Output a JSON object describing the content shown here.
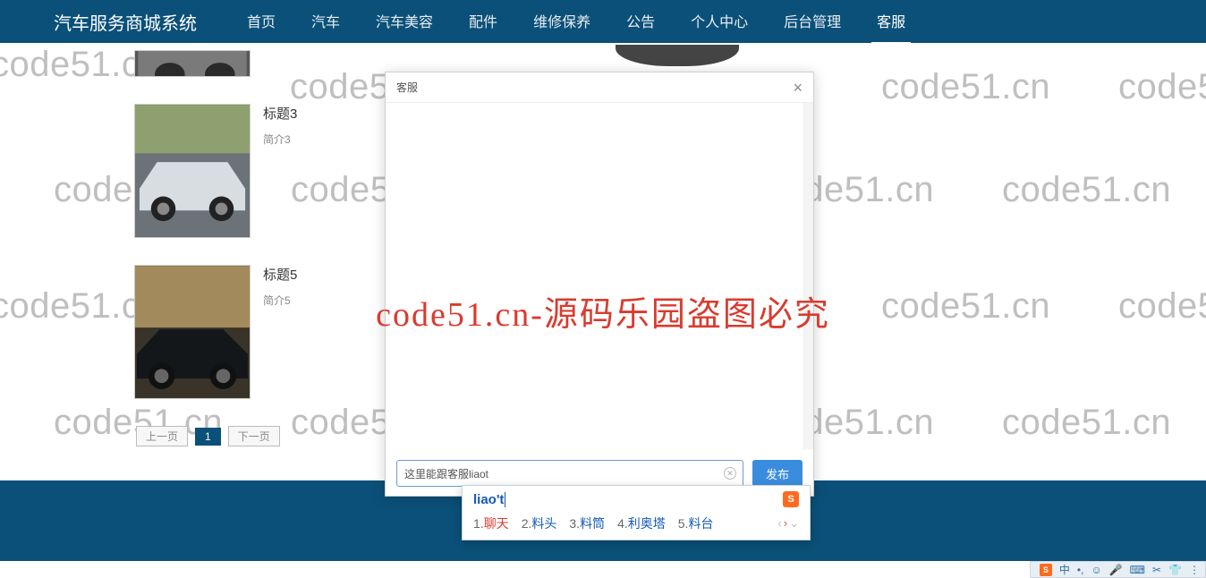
{
  "brand": "汽车服务商城系统",
  "nav": {
    "items": [
      {
        "label": "首页"
      },
      {
        "label": "汽车"
      },
      {
        "label": "汽车美容"
      },
      {
        "label": "配件"
      },
      {
        "label": "维修保养"
      },
      {
        "label": "公告"
      },
      {
        "label": "个人中心"
      },
      {
        "label": "后台管理"
      },
      {
        "label": "客服"
      }
    ],
    "active_index": 8
  },
  "cars": [
    {
      "title": "标题3",
      "sub": "简介3"
    },
    {
      "title": "标题5",
      "sub": "简介5"
    }
  ],
  "pager": {
    "prev": "上一页",
    "page": "1",
    "next": "下一页"
  },
  "modal": {
    "title": "客服",
    "close": "×",
    "input_value": "这里能跟客服liaot",
    "send": "发布"
  },
  "ime": {
    "pinyin": "liao't",
    "logo": "S",
    "candidates": [
      {
        "n": "1.",
        "t": "聊天"
      },
      {
        "n": "2.",
        "t": "料头"
      },
      {
        "n": "3.",
        "t": "料筒"
      },
      {
        "n": "4.",
        "t": "利奥塔"
      },
      {
        "n": "5.",
        "t": "料台"
      }
    ],
    "nav": {
      "prev": "‹",
      "next": "›",
      "down": "⌄"
    }
  },
  "tray": {
    "logo": "S",
    "items": [
      "中",
      "•,",
      "☺",
      "🎤",
      "⌨",
      "✂",
      "👕",
      "⋮"
    ]
  },
  "watermark_text": "code51.cn",
  "red_text": "code51.cn-源码乐园盗图必究"
}
